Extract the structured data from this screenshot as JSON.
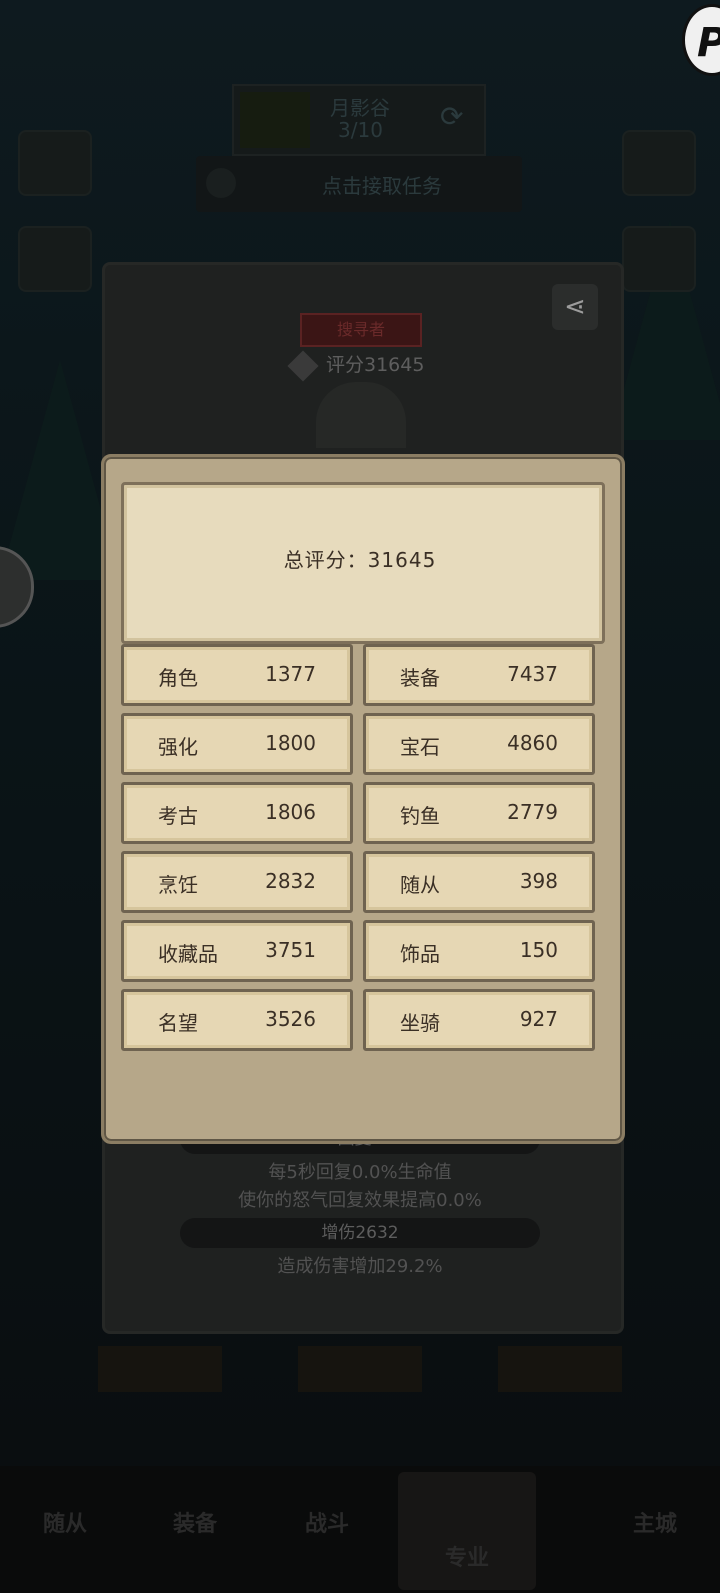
{
  "header": {
    "location_name": "月影谷",
    "location_progress": "3/10",
    "task_prompt": "点击接取任务"
  },
  "profile": {
    "title_badge": "搜寻者",
    "score_label": "评分31645"
  },
  "back_stats": {
    "recovery_heading": "回复0",
    "recovery_line_1": "每5秒回复0.0%生命值",
    "recovery_line_2": "使你的怒气回复效果提高0.0%",
    "damage_heading": "增伤2632",
    "damage_line": "造成伤害增加29.2%"
  },
  "modal": {
    "total_score": "总评分：31645",
    "items": [
      {
        "label": "角色",
        "value": "1377"
      },
      {
        "label": "装备",
        "value": "7437"
      },
      {
        "label": "强化",
        "value": "1800"
      },
      {
        "label": "宝石",
        "value": "4860"
      },
      {
        "label": "考古",
        "value": "1806"
      },
      {
        "label": "钓鱼",
        "value": "2779"
      },
      {
        "label": "烹饪",
        "value": "2832"
      },
      {
        "label": "随从",
        "value": "398"
      },
      {
        "label": "收藏品",
        "value": "3751"
      },
      {
        "label": "饰品",
        "value": "150"
      },
      {
        "label": "名望",
        "value": "3526"
      },
      {
        "label": "坐骑",
        "value": "927"
      }
    ]
  },
  "bottom_nav": {
    "items": [
      "随从",
      "装备",
      "战斗",
      "专业",
      "主城"
    ],
    "active": "专业"
  },
  "overlay_logo": "P",
  "colors": {
    "modal_bg": "#b6a789",
    "cell_bg": "#e6d7b4",
    "backdrop": "#0b1114"
  }
}
